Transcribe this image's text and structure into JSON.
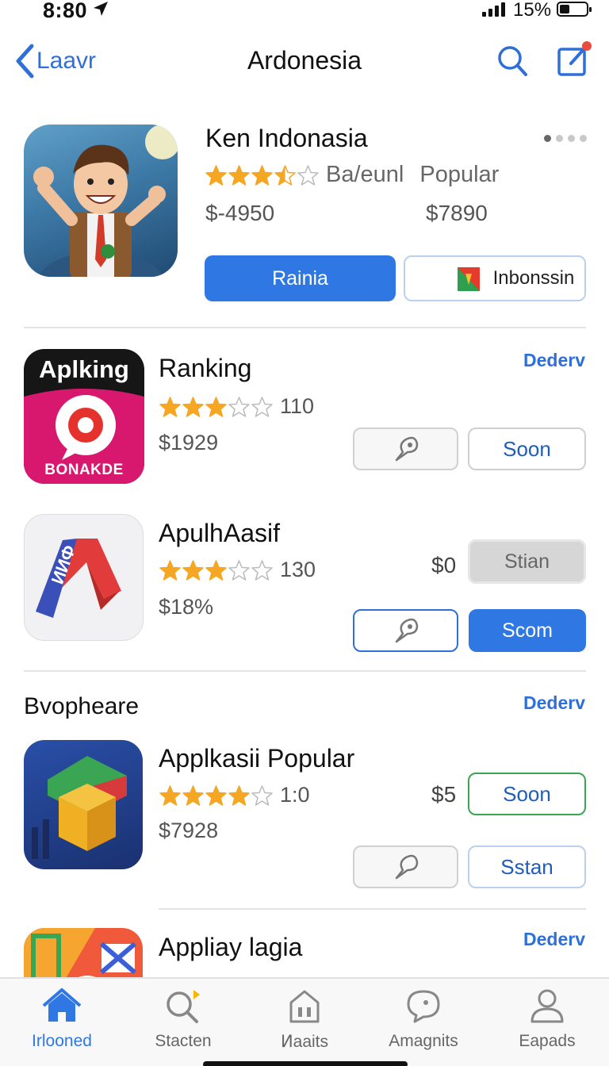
{
  "status": {
    "time": "8:80",
    "battery": "15%"
  },
  "nav": {
    "back_label": "Laavr",
    "title": "Ardonesia"
  },
  "featured": {
    "title": "Ken Indonasia",
    "rating": 3.5,
    "meta": "Ba/eunl",
    "category": "Popular",
    "price1": "$-4950",
    "price2": "$7890",
    "primary_button": "Rainia",
    "secondary_button": "Inbonssin"
  },
  "apps": [
    {
      "icon_text_top": "Aplking",
      "icon_text_bottom": "BONAKDE",
      "name": "Ranking",
      "rating": 3,
      "count": "110",
      "price": "$1929",
      "link": "Dederv",
      "button": "Soon"
    },
    {
      "name": "ApulhAasif",
      "rating": 3,
      "count": "130",
      "price": "$18%",
      "side_price": "$0",
      "grey_button": "Stian",
      "button": "Scom"
    }
  ],
  "section": {
    "title": "Bvopheare",
    "link": "Dederv",
    "apps": [
      {
        "name": "Applkasii Popular",
        "rating": 4,
        "count": "1:0",
        "price": "$7928",
        "side_price": "$5",
        "button": "Soon",
        "button2": "Sstan"
      },
      {
        "name": "Appliay lagia",
        "link": "Dederv"
      }
    ]
  },
  "tabs": [
    {
      "label": "Irlooned",
      "icon": "home-icon",
      "active": true
    },
    {
      "label": "Stacten",
      "icon": "search-icon",
      "active": false
    },
    {
      "label": "Ͷaaits",
      "icon": "apps-icon",
      "active": false
    },
    {
      "label": "Amagnits",
      "icon": "chat-icon",
      "active": false
    },
    {
      "label": "Eapads",
      "icon": "person-icon",
      "active": false
    }
  ],
  "colors": {
    "accent": "#2f78e4",
    "star": "#f5a623",
    "link": "#2f6fd8"
  }
}
